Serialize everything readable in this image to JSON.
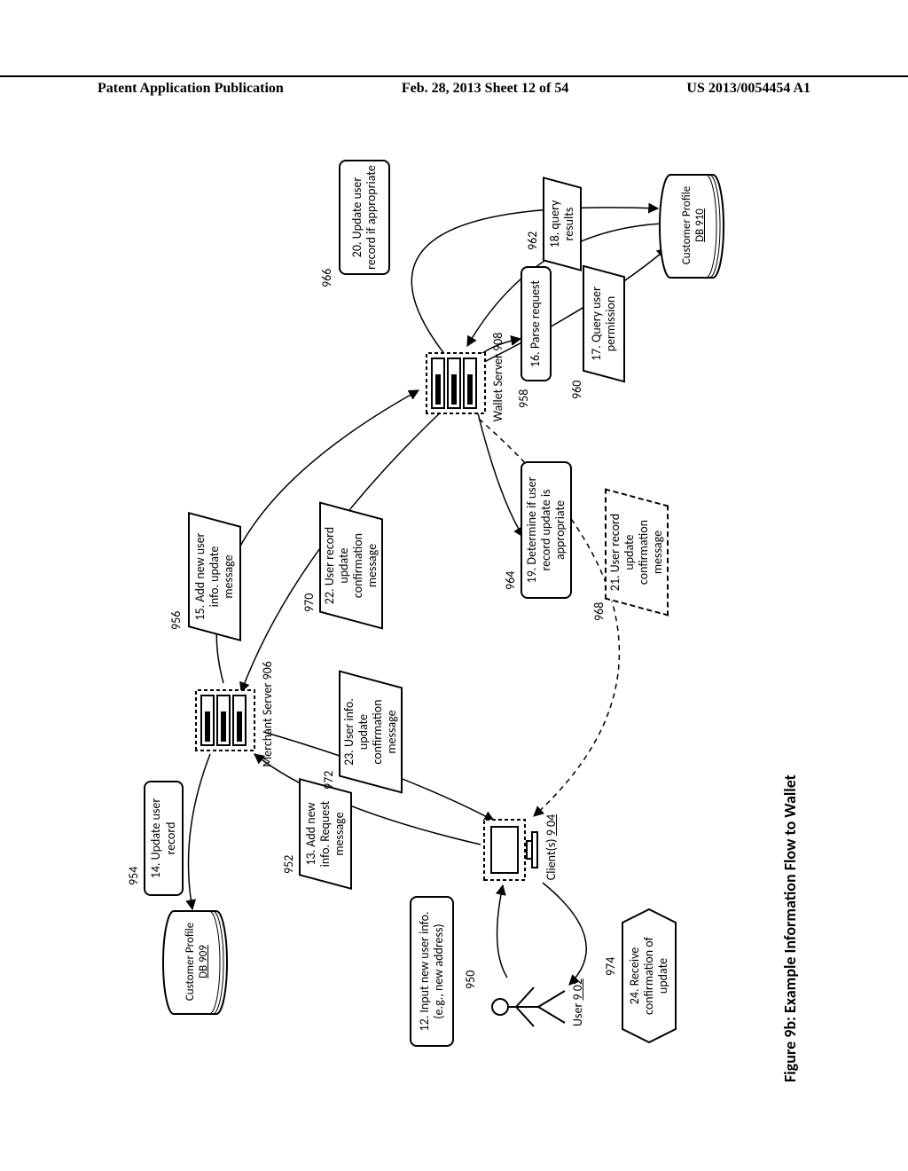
{
  "header": {
    "left": "Patent Application Publication",
    "center": "Feb. 28, 2013  Sheet 12 of 54",
    "right": "US 2013/0054454 A1"
  },
  "caption": "Figure 9b: Example Information Flow to Wallet",
  "refs": {
    "r950": "950",
    "r952": "952",
    "r954": "954",
    "r956": "956",
    "r958": "958",
    "r960": "960",
    "r962": "962",
    "r964": "964",
    "r966": "966",
    "r968": "968",
    "r970": "970",
    "r972": "972",
    "r974": "974"
  },
  "entities": {
    "user": "User 9 02",
    "client": "Client(s) 9 04",
    "merchant_server": "Merchant Server 906",
    "wallet_server": "Wallet Server 908",
    "db_merchant": "Customer Profile\nDB 909",
    "db_wallet": "Customer Profile\nDB 910"
  },
  "steps": {
    "s12": "12. Input new user info.\n(e.g., new address)",
    "s13": "13. Add new\ninfo. Request\nmessage",
    "s14": "14. Update user\nrecord",
    "s15": "15. Add new\nuser info.\nupdate message",
    "s16": "16. Parse request",
    "s17": "17. Query user\npermission",
    "s18": "18. query\nresults",
    "s19": "19. Determine if\nuser record update\nis appropriate",
    "s20": "20. Update user\nrecord if\nappropriate",
    "s21": "21. User record\nupdate\nconfirmation\nmessage",
    "s22": "22. User record\nupdate\nconfirmation\nmessage",
    "s23": "23. User info.\nupdate\nconfirmation\nmessage",
    "s24": "24. Receive\nconfirmation of\nupdate"
  }
}
